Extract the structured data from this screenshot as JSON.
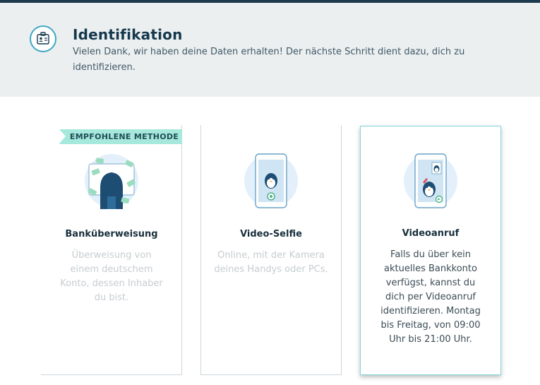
{
  "header": {
    "title": "Identifikation",
    "text": "Vielen Dank, wir haben deine Daten erhalten! Der nächste Schritt dient dazu, dich zu identifizieren."
  },
  "methods": [
    {
      "badge": "EMPFOHLENE METHODE",
      "title": "Banküberweisung",
      "description": "Überweisung von einem deutschem Konto, dessen Inhaber du bist.",
      "icon": "bank-transfer-illustration",
      "selected": false
    },
    {
      "title": "Video-Selfie",
      "description": "Online, mit der Kamera deines Handys oder PCs.",
      "icon": "video-selfie-illustration",
      "selected": false
    },
    {
      "title": "Videoanruf",
      "description": "Falls du über kein aktuelles Bankkonto verfügst, kannst du dich per Videoanruf identifizieren. Montag bis Freitag, von 09:00 Uhr bis 21:00 Uhr.",
      "icon": "video-call-illustration",
      "selected": true
    }
  ],
  "colors": {
    "accent": "#3fa8c2",
    "badge": "#a6e8dc",
    "selected_border": "#7fd6df",
    "header_bg": "#eceff0"
  }
}
